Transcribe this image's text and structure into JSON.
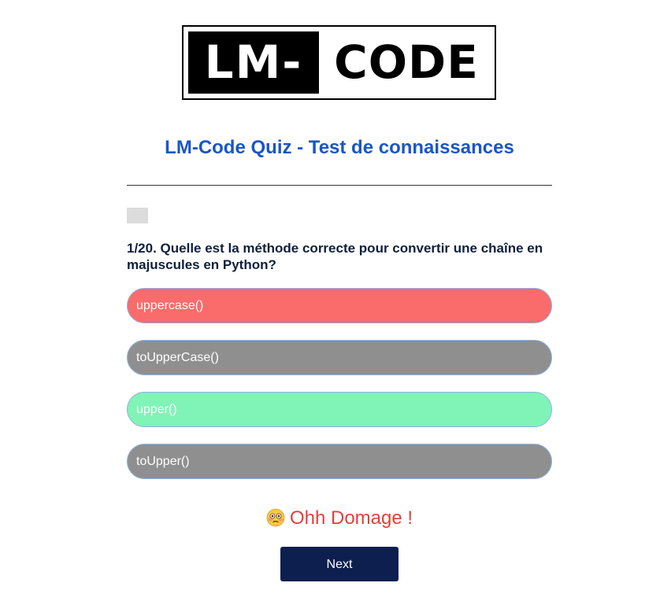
{
  "logo": {
    "left_text": "LM-",
    "right_text": "CODE"
  },
  "quiz": {
    "title": "LM-Code Quiz - Test de connaissances",
    "question": "1/20. Quelle est la méthode correcte pour convertir une chaîne en majuscules en Python?",
    "answers": [
      {
        "label": "uppercase()",
        "state": "wrong-selected",
        "color": "#fa6b6b"
      },
      {
        "label": "toUpperCase()",
        "state": "disabled",
        "color": "#908f8f"
      },
      {
        "label": "upper()",
        "state": "correct",
        "color": "#80f4b6"
      },
      {
        "label": "toUpper()",
        "state": "disabled",
        "color": "#908f8f"
      }
    ],
    "feedback": {
      "icon": "flushed-face-icon",
      "text": "Ohh Domage !",
      "color": "#e2413c"
    },
    "next_label": "Next"
  },
  "colors": {
    "title": "#1a56c4",
    "question": "#0e1f3f",
    "next_button": "#0d1f4f",
    "progress_track": "#dcdcdc"
  }
}
